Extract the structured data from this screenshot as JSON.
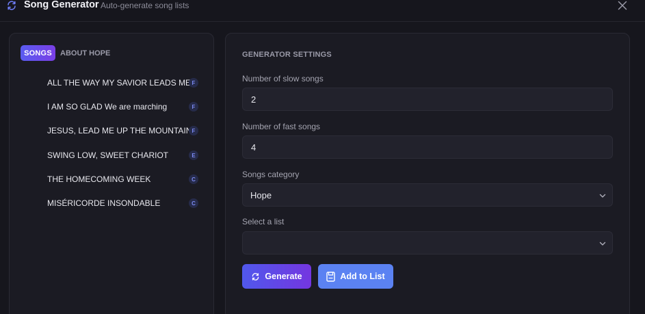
{
  "app": {
    "title": "Song Generator",
    "subtitle": "Auto-generate song lists",
    "icon": "refresh-icon",
    "close_icon": "close-icon"
  },
  "tabs": [
    {
      "label": "SONGS",
      "active": true
    },
    {
      "label": "ABOUT HOPE",
      "active": false
    }
  ],
  "songs": [
    {
      "title": "ALL THE WAY MY SAVIOR LEADS ME",
      "key": "F"
    },
    {
      "title": "I AM SO GLAD We are marching",
      "key": "F"
    },
    {
      "title": "JESUS, LEAD ME UP THE MOUNTAIN",
      "key": "F"
    },
    {
      "title": "SWING LOW, SWEET CHARIOT",
      "key": "E"
    },
    {
      "title": "THE HOMECOMING WEEK",
      "key": "C"
    },
    {
      "title": "MISÉRICORDE INSONDABLE",
      "key": "C"
    }
  ],
  "settings": {
    "heading": "GENERATOR SETTINGS",
    "slow_label": "Number of slow songs",
    "slow_value": "2",
    "fast_label": "Number of fast songs",
    "fast_value": "4",
    "category_label": "Songs category",
    "category_value": "Hope",
    "list_label": "Select a list",
    "list_value": ""
  },
  "buttons": {
    "generate": "Generate",
    "add_to_list": "Add to List"
  },
  "colors": {
    "accent_gradient_start": "#5058ec",
    "accent_gradient_end": "#7436e0",
    "add_button": "#5b82f2",
    "background": "#16161d",
    "panel": "#1b1b23"
  }
}
